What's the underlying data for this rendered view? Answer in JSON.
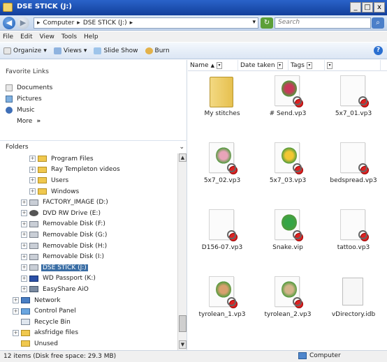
{
  "window": {
    "title": "DSE STICK (J:)",
    "buttons": [
      "_",
      "□",
      "x"
    ]
  },
  "address": {
    "crumbs": [
      "Computer",
      "DSE STICK (J:)"
    ],
    "separator": "▸",
    "search_placeholder": "Search"
  },
  "menu": [
    "File",
    "Edit",
    "View",
    "Tools",
    "Help"
  ],
  "toolbar": {
    "organize": "Organize",
    "views": "Views",
    "slideshow": "Slide Show",
    "burn": "Burn"
  },
  "left": {
    "favorites_title": "Favorite Links",
    "favorites": [
      "Documents",
      "Pictures",
      "Music"
    ],
    "more": "More",
    "more_glyph": "»",
    "folders_title": "Folders",
    "tree": [
      {
        "label": "Program Files",
        "indent": 3,
        "exp": true,
        "icon": "folder-icon"
      },
      {
        "label": "Ray Templeton videos",
        "indent": 3,
        "exp": true,
        "icon": "folder-icon"
      },
      {
        "label": "Users",
        "indent": 3,
        "exp": true,
        "icon": "folder-icon"
      },
      {
        "label": "Windows",
        "indent": 3,
        "exp": true,
        "icon": "folder-icon"
      },
      {
        "label": "FACTORY_IMAGE (D:)",
        "indent": 2,
        "exp": true,
        "icon": "drive-icon"
      },
      {
        "label": "DVD RW Drive (E:)",
        "indent": 2,
        "exp": true,
        "icon": "dvd-icon"
      },
      {
        "label": "Removable Disk (F:)",
        "indent": 2,
        "exp": true,
        "icon": "drive-icon"
      },
      {
        "label": "Removable Disk (G:)",
        "indent": 2,
        "exp": true,
        "icon": "drive-icon"
      },
      {
        "label": "Removable Disk (H:)",
        "indent": 2,
        "exp": true,
        "icon": "drive-icon"
      },
      {
        "label": "Removable Disk (I:)",
        "indent": 2,
        "exp": true,
        "icon": "drive-icon"
      },
      {
        "label": "DSE STICK (J:)",
        "indent": 2,
        "exp": true,
        "icon": "drive-icon",
        "selected": true
      },
      {
        "label": "WD Passport (K:)",
        "indent": 2,
        "exp": true,
        "icon": "passport-icon"
      },
      {
        "label": "EasyShare AiO",
        "indent": 2,
        "exp": true,
        "icon": "printer-icon"
      },
      {
        "label": "Network",
        "indent": 1,
        "exp": true,
        "icon": "network-icon"
      },
      {
        "label": "Control Panel",
        "indent": 1,
        "exp": true,
        "icon": "control-panel-icon"
      },
      {
        "label": "Recycle Bin",
        "indent": 1,
        "exp": false,
        "icon": "recycle-bin-icon"
      },
      {
        "label": "aksfridge files",
        "indent": 1,
        "exp": true,
        "icon": "folder-icon"
      },
      {
        "label": "Unused",
        "indent": 1,
        "exp": false,
        "icon": "folder-icon"
      }
    ]
  },
  "columns": [
    "Name",
    "Date taken",
    "Tags"
  ],
  "files": [
    {
      "name": "My stitches",
      "kind": "folder"
    },
    {
      "name": "# Send.vp3",
      "kind": "flower",
      "color": "#c8395a"
    },
    {
      "name": "5x7_01.vp3",
      "kind": "blank"
    },
    {
      "name": "5x7_02.vp3",
      "kind": "flower",
      "color": "#e9a4b9"
    },
    {
      "name": "5x7_03.vp3",
      "kind": "flower",
      "color": "#f2c733"
    },
    {
      "name": "bedspread.vp3",
      "kind": "blank"
    },
    {
      "name": "D156-07.vp3",
      "kind": "blank"
    },
    {
      "name": "Snake.vip",
      "kind": "flower",
      "color": "#35a546"
    },
    {
      "name": "tattoo.vp3",
      "kind": "blank"
    },
    {
      "name": "tyrolean_1.vp3",
      "kind": "flower",
      "color": "#d8a06e"
    },
    {
      "name": "tyrolean_2.vp3",
      "kind": "flower",
      "color": "#d3b48a"
    },
    {
      "name": "vDirectory.idb",
      "kind": "doc"
    }
  ],
  "status": {
    "left": "12 items (Disk free space: 29.3 MB)",
    "right": "Computer"
  }
}
